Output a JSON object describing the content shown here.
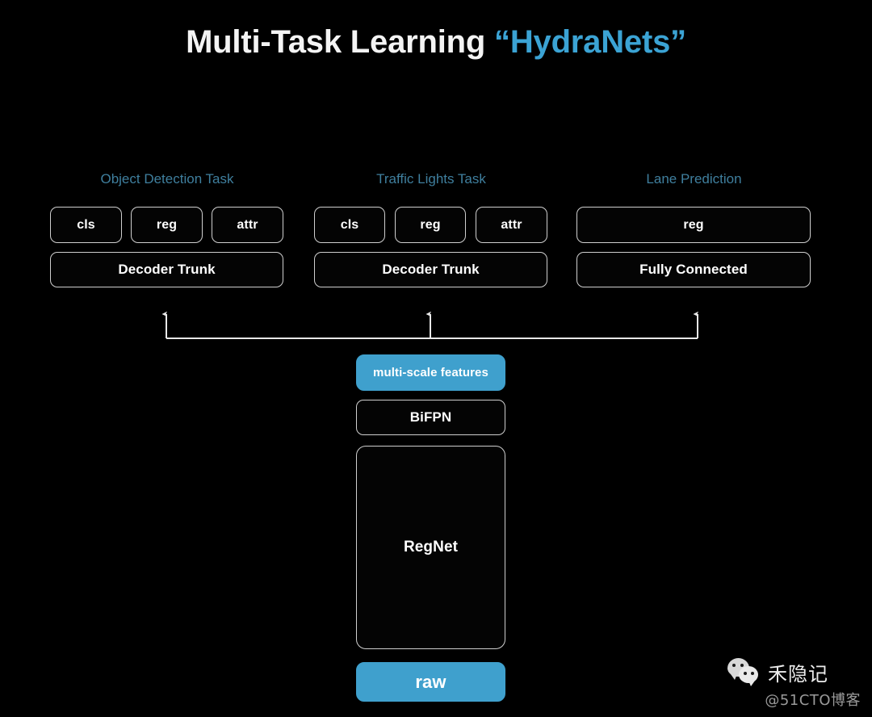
{
  "title": {
    "main": "Multi-Task Learning ",
    "highlight": "“HydraNets”"
  },
  "colors": {
    "background": "#000000",
    "title_white": "#f4f4f4",
    "title_blue": "#3ba3d4",
    "task_label_blue": "#3f7f9e",
    "box_border": "#cfcfcf",
    "accent_fill": "#3fa0cd",
    "text_white": "#ffffff"
  },
  "tasks": [
    {
      "label": "Object Detection Task",
      "heads": [
        "cls",
        "reg",
        "attr"
      ],
      "trunk": "Decoder Trunk"
    },
    {
      "label": "Traffic Lights Task",
      "heads": [
        "cls",
        "reg",
        "attr"
      ],
      "trunk": "Decoder Trunk"
    },
    {
      "label": "Lane Prediction",
      "heads": [
        "reg"
      ],
      "trunk": "Fully Connected"
    }
  ],
  "backbone": [
    {
      "label": "multi-scale features",
      "style": "filled"
    },
    {
      "label": "BiFPN",
      "style": "outline"
    },
    {
      "label": "RegNet",
      "style": "outline"
    },
    {
      "label": "raw",
      "style": "filled"
    }
  ],
  "watermark": {
    "name": "禾隐记",
    "handle": "@51CTO博客"
  }
}
